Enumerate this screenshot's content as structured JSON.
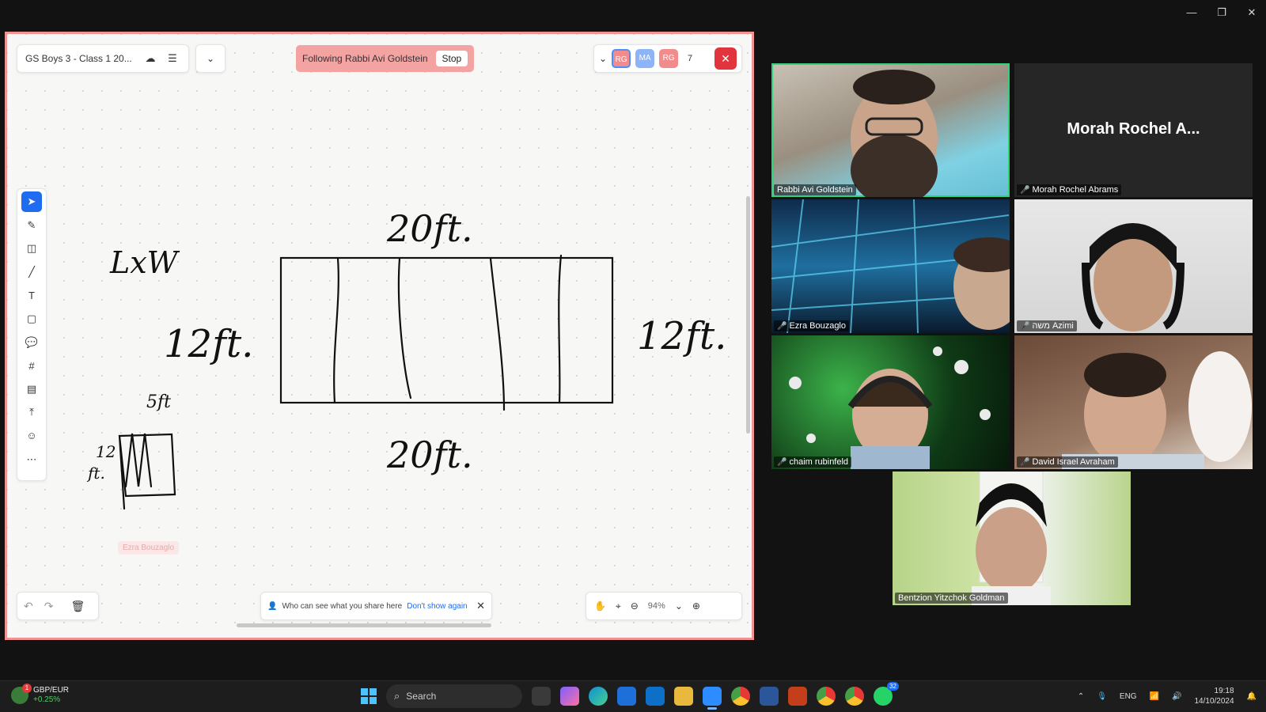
{
  "window_controls": {
    "minimize": "—",
    "restore": "❐",
    "close": "✕"
  },
  "whiteboard": {
    "title": "GS Boys 3 - Class 1 20...",
    "following_text": "Following Rabbi Avi Goldstein",
    "stop_label": "Stop",
    "avatars": [
      "RG",
      "MA",
      "RG"
    ],
    "participant_count": "7",
    "ghost_label": "Ezra Bouzaglo",
    "share_notice": "Who can see what you share here",
    "dont_show_label": "Don't show again",
    "zoom_level": "94%",
    "tools": [
      "select-tool",
      "pen-tool",
      "shapes-tool",
      "line-tool",
      "text-tool",
      "sticky-note-tool",
      "comment-tool",
      "frame-tool",
      "template-tool",
      "upload-tool",
      "emoji-tool",
      "more-tool"
    ]
  },
  "handwriting": {
    "top_dim": "20ft.",
    "bottom_dim": "20ft.",
    "left_dim": "12ft.",
    "right_dim": "12ft.",
    "formula": "LxW",
    "small_top": "5ft",
    "small_left_1": "12",
    "small_left_2": "ft."
  },
  "participants": [
    {
      "name": "Rabbi Avi Goldstein",
      "muted": false,
      "speaking": true
    },
    {
      "name": "Morah Rochel Abrams",
      "display": "Morah Rochel A...",
      "muted": true,
      "video": false
    },
    {
      "name": "Ezra Bouzaglo",
      "muted": true
    },
    {
      "name": "משה Azimi",
      "muted": true
    },
    {
      "name": "chaim rubinfeld",
      "muted": true
    },
    {
      "name": "David Israel Avraham",
      "muted": true
    },
    {
      "name": "Bentzion Yitzchok Goldman",
      "muted": false
    }
  ],
  "taskbar": {
    "ticker_name": "GBP/EUR",
    "ticker_change": "+0.25%",
    "search_placeholder": "Search",
    "language": "ENG",
    "time": "19:18",
    "date": "14/10/2024",
    "whatsapp_badge": "32"
  }
}
